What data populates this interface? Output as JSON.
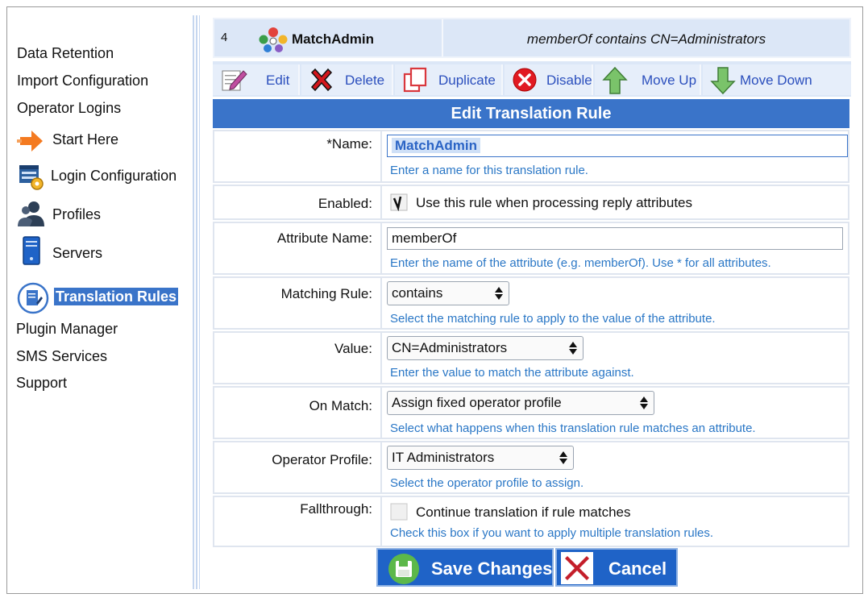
{
  "sidebar": {
    "items": [
      {
        "label": "Data Retention"
      },
      {
        "label": "Import Configuration"
      },
      {
        "label": "Operator Logins"
      },
      {
        "label": "Start Here"
      },
      {
        "label": "Login Configuration"
      },
      {
        "label": "Profiles"
      },
      {
        "label": "Servers"
      },
      {
        "label": "Translation Rules",
        "active": true
      },
      {
        "label": "Plugin Manager"
      },
      {
        "label": "SMS Services"
      },
      {
        "label": "Support"
      }
    ]
  },
  "rule": {
    "number": "4",
    "name": "MatchAdmin",
    "condition": "memberOf contains CN=Administrators",
    "icon": "user-group-icon"
  },
  "toolbar": {
    "edit": "Edit",
    "delete": "Delete",
    "duplicate": "Duplicate",
    "disable": "Disable",
    "move_up": "Move Up",
    "move_down": "Move Down"
  },
  "form": {
    "title": "Edit Translation Rule",
    "name": {
      "label": "*Name:",
      "value": "MatchAdmin",
      "help": "Enter a name for this translation rule."
    },
    "enabled": {
      "label": "Enabled:",
      "checked": true,
      "text": "Use this rule when processing reply attributes"
    },
    "attribute_name": {
      "label": "Attribute Name:",
      "value": "memberOf",
      "help": "Enter the name of the attribute (e.g. memberOf). Use * for all attributes."
    },
    "matching_rule": {
      "label": "Matching Rule:",
      "value": "contains",
      "help": "Select the matching rule to apply to the value of the attribute."
    },
    "value": {
      "label": "Value:",
      "value": "CN=Administrators",
      "help": "Enter the value to match the attribute against."
    },
    "on_match": {
      "label": "On Match:",
      "value": "Assign fixed operator profile",
      "help": "Select what happens when this translation rule matches an attribute."
    },
    "operator_profile": {
      "label": "Operator Profile:",
      "value": "IT Administrators",
      "help": "Select the operator profile to assign."
    },
    "fallthrough": {
      "label": "Fallthrough:",
      "checked": false,
      "text": "Continue translation if rule matches",
      "help": "Check this box if you want to apply multiple translation rules."
    }
  },
  "actions": {
    "save": "Save Changes",
    "cancel": "Cancel"
  },
  "colors": {
    "accent": "#3a74c9",
    "help_text": "#2a77c6",
    "toolbar_text": "#2b4fbd",
    "button_bg": "#1f63c7"
  }
}
